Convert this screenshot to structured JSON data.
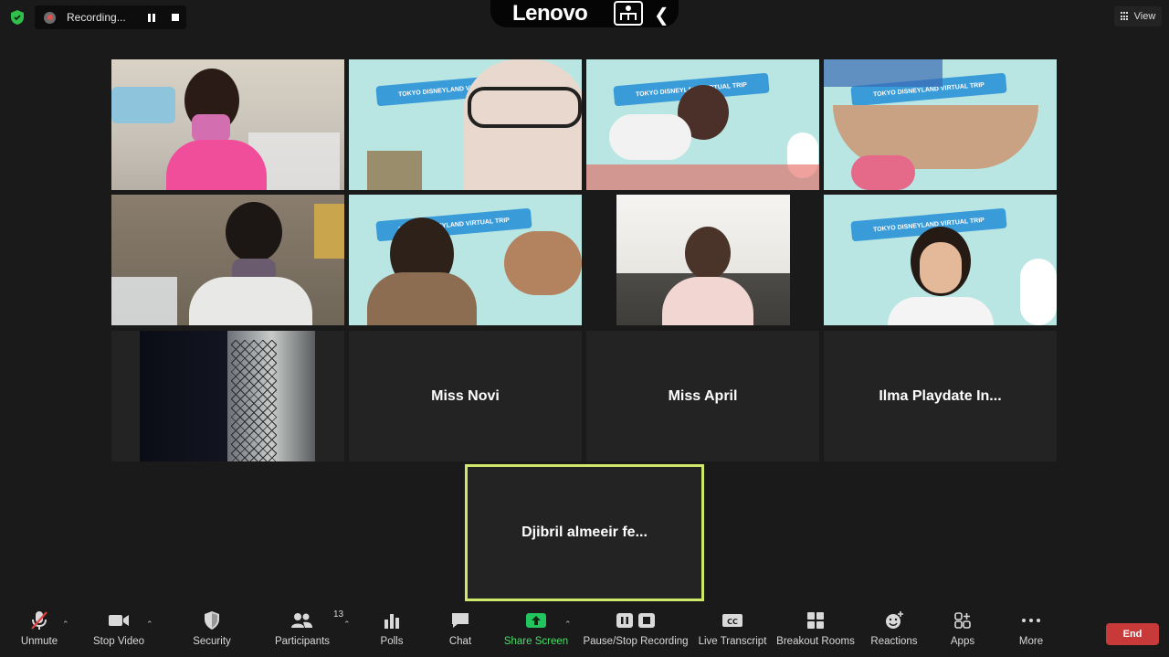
{
  "recording": {
    "label": "Recording..."
  },
  "brand": {
    "name": "Lenovo"
  },
  "view": {
    "label": "View"
  },
  "tiles_named": [
    {
      "name": "Miss Novi"
    },
    {
      "name": "Miss April"
    },
    {
      "name": "Ilma Playdate In..."
    }
  ],
  "spotlight": {
    "name": "Djibril almeeir fe..."
  },
  "banner_text": "TOKYO DISNEYLAND VIRTUAL TRIP",
  "toolbar": {
    "unmute": "Unmute",
    "stop_video": "Stop Video",
    "security": "Security",
    "participants": "Participants",
    "participant_count": "13",
    "polls": "Polls",
    "chat": "Chat",
    "share_screen": "Share Screen",
    "pause_stop_recording": "Pause/Stop Recording",
    "live_transcript": "Live Transcript",
    "breakout_rooms": "Breakout Rooms",
    "reactions": "Reactions",
    "apps": "Apps",
    "more": "More",
    "end": "End"
  },
  "colors": {
    "accent_green": "#22c55e",
    "spotlight_border": "#cde86a",
    "end_red": "#c83a3a",
    "background": "#1a1a1a"
  }
}
